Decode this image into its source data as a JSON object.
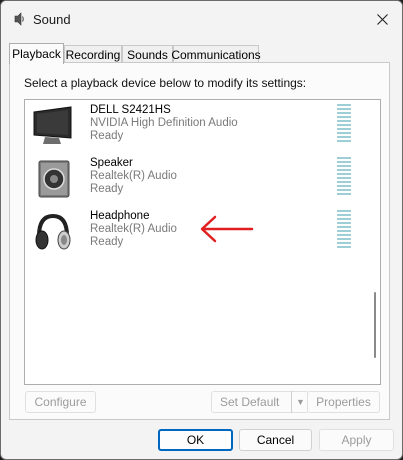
{
  "window": {
    "title": "Sound"
  },
  "tabs": [
    "Playback",
    "Recording",
    "Sounds",
    "Communications"
  ],
  "instruction": "Select a playback device below to modify its settings:",
  "devices": [
    {
      "name": "DELL S2421HS",
      "driver": "NVIDIA High Definition Audio",
      "status": "Ready",
      "icon": "monitor-icon"
    },
    {
      "name": "Speaker",
      "driver": "Realtek(R) Audio",
      "status": "Ready",
      "icon": "speaker-icon"
    },
    {
      "name": "Headphone",
      "driver": "Realtek(R) Audio",
      "status": "Ready",
      "icon": "headphone-icon"
    }
  ],
  "panel_buttons": {
    "configure": "Configure",
    "set_default": "Set Default",
    "properties": "Properties"
  },
  "footer_buttons": {
    "ok": "OK",
    "cancel": "Cancel",
    "apply": "Apply"
  },
  "colors": {
    "accent": "#0067c0",
    "annotation_arrow": "#e02020",
    "meter": "#9ecfd6"
  }
}
